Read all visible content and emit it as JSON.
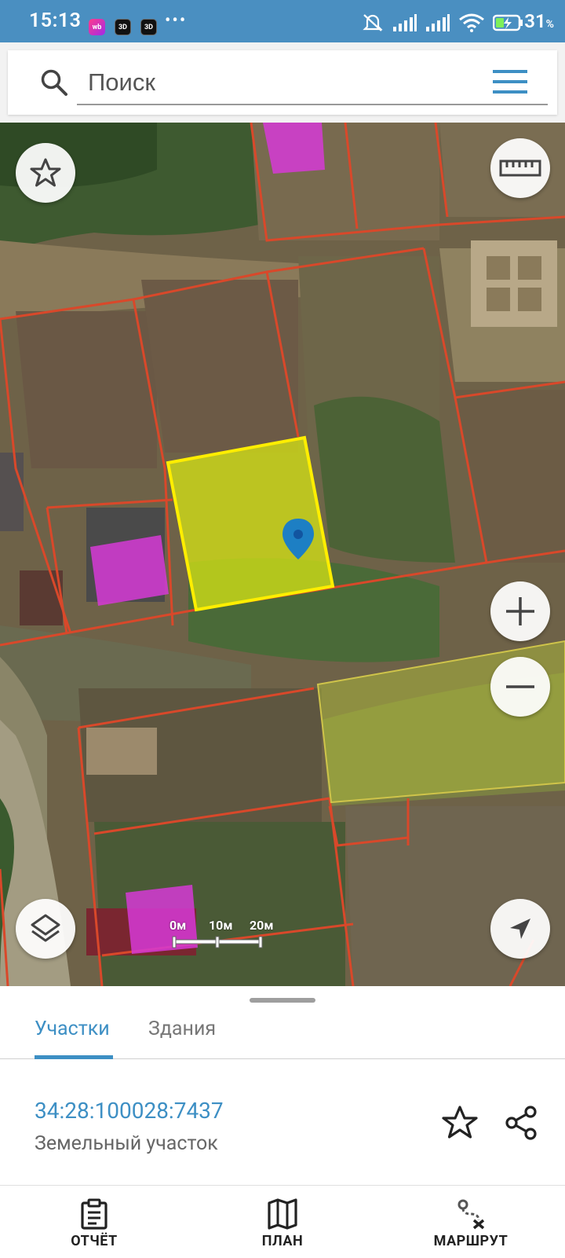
{
  "status_bar": {
    "time": "15:13",
    "badges": [
      "wb",
      "3D",
      "3D"
    ],
    "overflow": "•••",
    "battery_percent": "31",
    "battery_unit": "%"
  },
  "search": {
    "placeholder": "Поиск"
  },
  "map": {
    "scale_labels": [
      "0м",
      "10м",
      "20м"
    ]
  },
  "sheet": {
    "tabs": [
      {
        "label": "Участки",
        "active": true
      },
      {
        "label": "Здания",
        "active": false
      }
    ],
    "result": {
      "cadastral_number": "34:28:100028:7437",
      "type": "Земельный участок"
    }
  },
  "bottom_nav": {
    "items": [
      {
        "label": "ОТЧЁТ",
        "icon": "clipboard-icon"
      },
      {
        "label": "ПЛАН",
        "icon": "map-icon"
      },
      {
        "label": "МАРШРУТ",
        "icon": "route-icon"
      }
    ]
  },
  "colors": {
    "status_bar": "#4a8fc1",
    "accent": "#3d8fc4",
    "parcel_border": "#d9482a",
    "selected_parcel": "#ffee00",
    "building": "#d63ad6"
  }
}
